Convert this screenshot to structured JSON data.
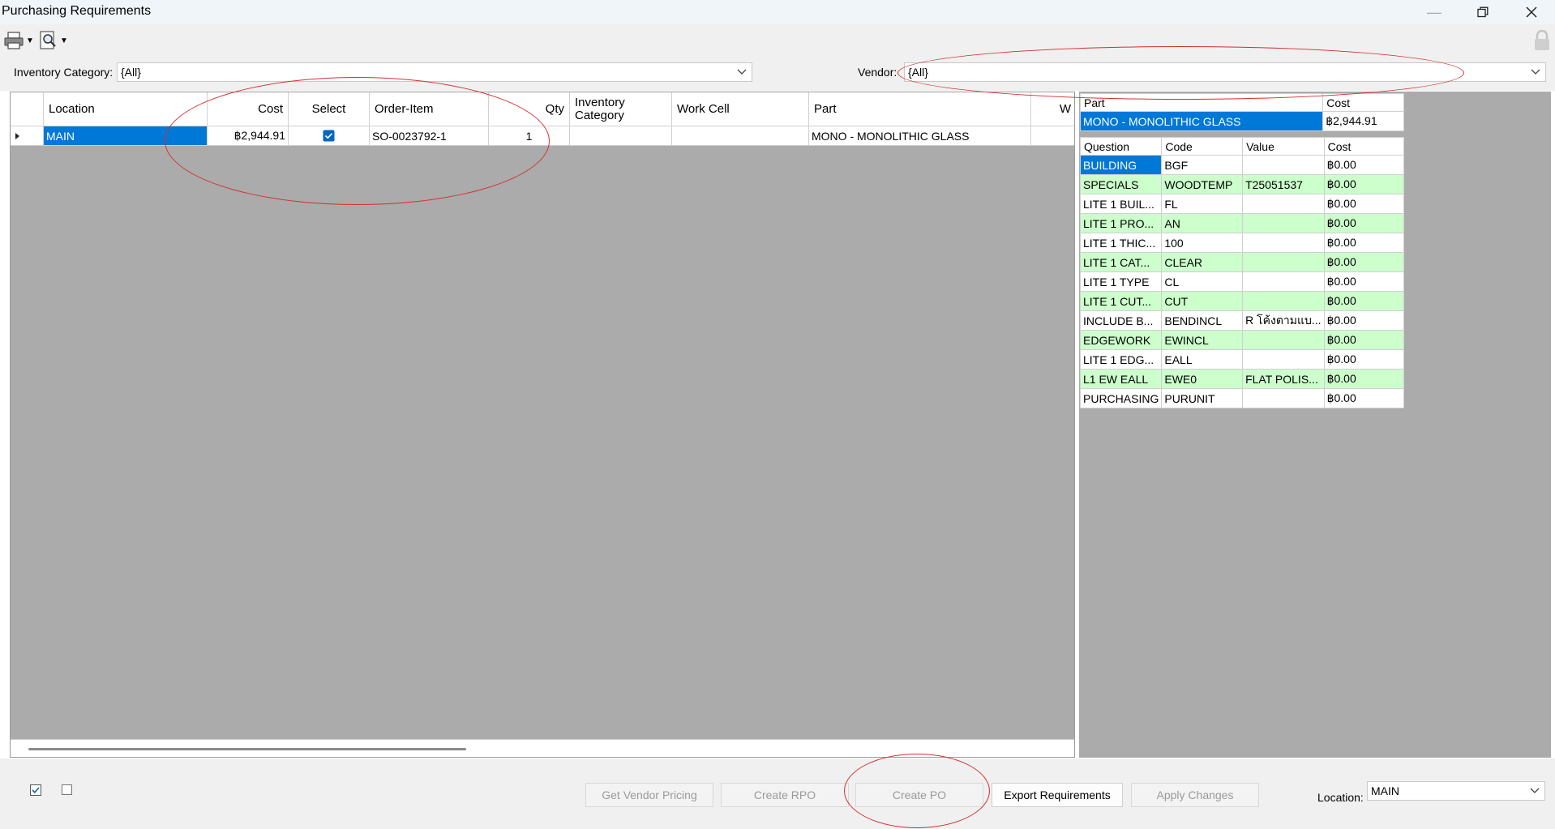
{
  "window": {
    "title": "Purchasing Requirements"
  },
  "filters": {
    "inventory_category_label": "Inventory Category:",
    "inventory_category_value": "{All}",
    "vendor_label": "Vendor:",
    "vendor_value": "{All}"
  },
  "main_grid": {
    "columns": [
      "Location",
      "Cost",
      "Select",
      "Order-Item",
      "Qty",
      "Inventory Category",
      "Work Cell",
      "Part",
      "W"
    ],
    "rows": [
      {
        "location": "MAIN",
        "cost": "฿2,944.91",
        "select": true,
        "order_item": "SO-0023792-1",
        "qty": "1",
        "inventory_category": "",
        "work_cell": "",
        "part": "MONO - MONOLITHIC GLASS",
        "w": ""
      }
    ]
  },
  "part_table": {
    "columns": [
      "Part",
      "Cost"
    ],
    "rows": [
      {
        "part": "MONO - MONOLITHIC GLASS",
        "cost": "฿2,944.91"
      }
    ]
  },
  "question_table": {
    "columns": [
      "Question",
      "Code",
      "Value",
      "Cost"
    ],
    "rows": [
      {
        "question": "BUILDING",
        "code": "BGF",
        "value": "",
        "cost": "฿0.00",
        "green": false,
        "selected": true
      },
      {
        "question": "SPECIALS",
        "code": "WOODTEMP",
        "value": "T25051537",
        "cost": "฿0.00",
        "green": true
      },
      {
        "question": "LITE 1 BUIL...",
        "code": "FL",
        "value": "",
        "cost": "฿0.00",
        "green": false
      },
      {
        "question": "LITE 1 PRO...",
        "code": "AN",
        "value": "",
        "cost": "฿0.00",
        "green": true
      },
      {
        "question": "LITE 1 THIC...",
        "code": "100",
        "value": "",
        "cost": "฿0.00",
        "green": false
      },
      {
        "question": "LITE 1 CAT...",
        "code": "CLEAR",
        "value": "",
        "cost": "฿0.00",
        "green": true
      },
      {
        "question": "LITE 1 TYPE",
        "code": "CL",
        "value": "",
        "cost": "฿0.00",
        "green": false
      },
      {
        "question": "LITE 1 CUT...",
        "code": "CUT",
        "value": "",
        "cost": "฿0.00",
        "green": true
      },
      {
        "question": "INCLUDE B...",
        "code": "BENDINCL",
        "value": "R โค้งตามแบ...",
        "cost": "฿0.00",
        "green": false
      },
      {
        "question": "EDGEWORK",
        "code": "EWINCL",
        "value": "",
        "cost": "฿0.00",
        "green": true
      },
      {
        "question": "LITE 1 EDG...",
        "code": "EALL",
        "value": "",
        "cost": "฿0.00",
        "green": false
      },
      {
        "question": "L1 EW EALL",
        "code": "EWE0",
        "value": "FLAT POLIS...",
        "cost": "฿0.00",
        "green": true
      },
      {
        "question": "PURCHASING",
        "code": "PURUNIT",
        "value": "",
        "cost": "฿0.00",
        "green": false
      }
    ]
  },
  "bottom": {
    "buttons": {
      "get_vendor_pricing": "Get Vendor Pricing",
      "create_rpo": "Create RPO",
      "create_po": "Create PO",
      "export_requirements": "Export Requirements",
      "apply_changes": "Apply Changes"
    },
    "location_label": "Location:",
    "location_value": "MAIN"
  },
  "colors": {
    "selection": "#0078d7",
    "highlight_green": "#ccffcc",
    "annotation": "#d32f2f",
    "grid_background": "#ababab"
  },
  "icons": [
    "printer-icon",
    "zoom-preview-icon",
    "lock-icon",
    "minimize-icon",
    "restore-icon",
    "close-icon",
    "dropdown-arrow-icon",
    "checkbox-icon"
  ]
}
